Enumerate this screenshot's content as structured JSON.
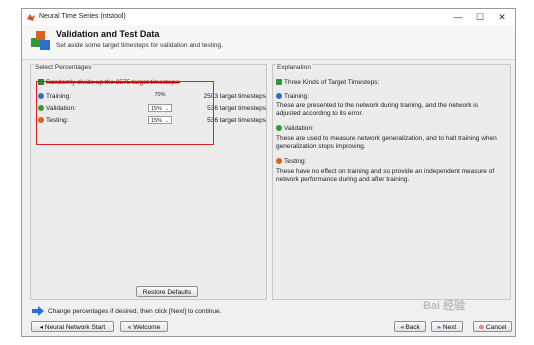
{
  "window": {
    "title": "Neural Time Series (ntstool)",
    "minimize": "—",
    "maximize": "☐",
    "close": "✕"
  },
  "header": {
    "title": "Validation and Test Data",
    "subtitle": "Set aside some target timesteps for validation and testing."
  },
  "left_panel": {
    "label": "Select Percentages",
    "divide_text": "Randomly divide up the 2575 target timesteps:",
    "rows": [
      {
        "label": "Training:",
        "percent": "70%",
        "timesteps": "2503 target timesteps"
      },
      {
        "label": "Validation:",
        "percent": "15%",
        "timesteps": "536 target timesteps"
      },
      {
        "label": "Testing:",
        "percent": "15%",
        "timesteps": "536 target timesteps"
      }
    ],
    "restore_button": "Restore Defaults"
  },
  "right_panel": {
    "label": "Explanation",
    "heading": "Three Kinds of Target Timesteps:",
    "training_title": "Training:",
    "training_l1": "These are presented to the network during training, and the network is",
    "training_l2": "adjusted according to its error.",
    "validation_title": "Validation:",
    "validation_l1": "These are used to measure network generalization, and to halt training when",
    "validation_l2": "generalization stops improving.",
    "testing_title": "Testing:",
    "testing_l1": "These have no effect on training and so provide an independent measure of",
    "testing_l2": "network performance during and after training."
  },
  "footer": {
    "note": "Change percentages if desired, then click [Next] to continue.",
    "nn_start": "Neural Network Start",
    "welcome": "Welcome",
    "back": "Back",
    "next": "Next",
    "cancel": "Cancel"
  },
  "watermark": "Bai 经验"
}
